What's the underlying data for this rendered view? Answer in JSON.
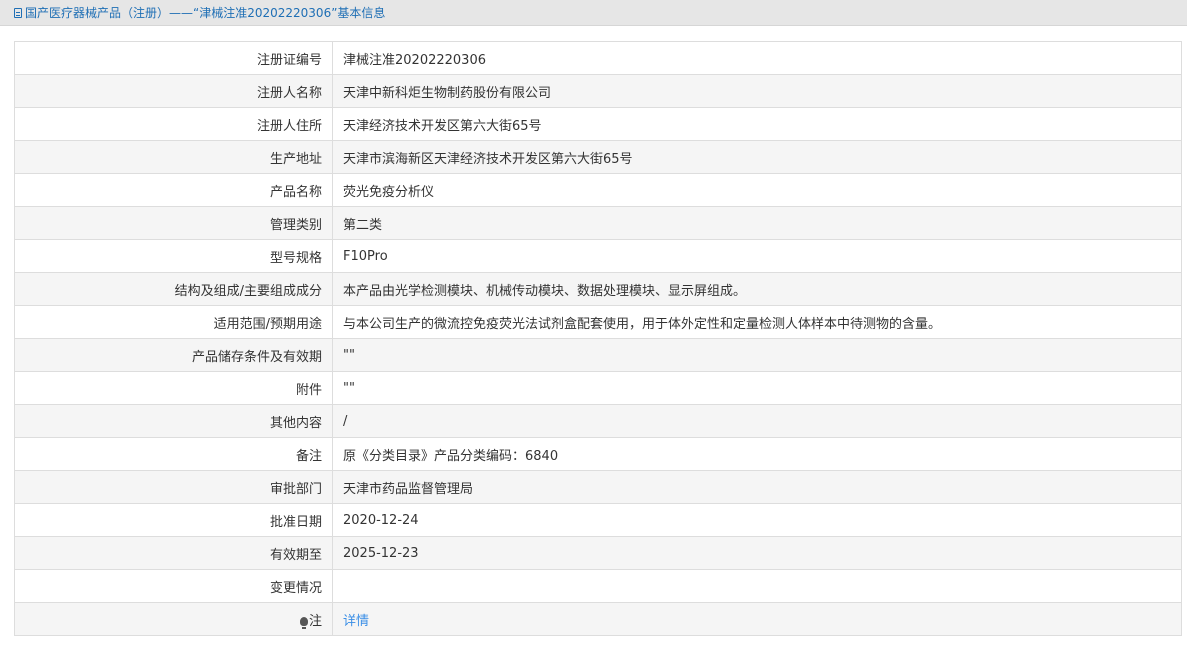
{
  "breadcrumb": {
    "icon": "document-icon",
    "text": "国产医疗器械产品（注册）——“津械注准20202220306”基本信息",
    "color": "#1f6fb5"
  },
  "rows": [
    {
      "label": "注册证编号",
      "value": "津械注准20202220306"
    },
    {
      "label": "注册人名称",
      "value": "天津中新科炬生物制药股份有限公司"
    },
    {
      "label": "注册人住所",
      "value": "天津经济技术开发区第六大街65号"
    },
    {
      "label": "生产地址",
      "value": "天津市滨海新区天津经济技术开发区第六大街65号"
    },
    {
      "label": "产品名称",
      "value": "荧光免疫分析仪"
    },
    {
      "label": "管理类别",
      "value": "第二类"
    },
    {
      "label": "型号规格",
      "value": "F10Pro"
    },
    {
      "label": "结构及组成/主要组成成分",
      "value": "本产品由光学检测模块、机械传动模块、数据处理模块、显示屏组成。"
    },
    {
      "label": "适用范围/预期用途",
      "value": "与本公司生产的微流控免疫荧光法试剂盒配套使用，用于体外定性和定量检测人体样本中待测物的含量。"
    },
    {
      "label": "产品储存条件及有效期",
      "value": "\"\""
    },
    {
      "label": "附件",
      "value": "\"\""
    },
    {
      "label": "其他内容",
      "value": "/"
    },
    {
      "label": "备注",
      "value": "原《分类目录》产品分类编码：6840"
    },
    {
      "label": "审批部门",
      "value": "天津市药品监督管理局"
    },
    {
      "label": "批准日期",
      "value": "2020-12-24"
    },
    {
      "label": "有效期至",
      "value": "2025-12-23"
    },
    {
      "label": "变更情况",
      "value": ""
    }
  ],
  "note": {
    "icon": "lightbulb-icon",
    "label": "注",
    "link_text": "详情",
    "link_color": "#3a8ee6"
  }
}
